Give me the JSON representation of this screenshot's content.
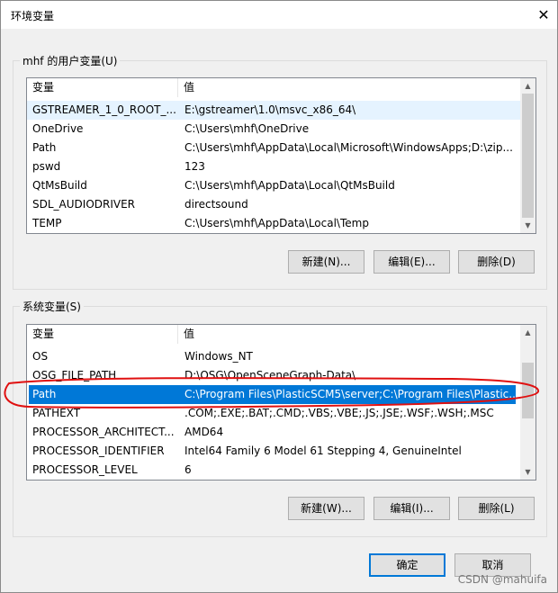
{
  "window": {
    "title": "环境变量",
    "close_glyph": "✕"
  },
  "user_vars": {
    "group_label": "mhf 的用户变量(U)",
    "columns": [
      "变量",
      "值"
    ],
    "rows": [
      {
        "name": "GSTREAMER_1_0_ROOT_...",
        "value": "E:\\gstreamer\\1.0\\msvc_x86_64\\"
      },
      {
        "name": "OneDrive",
        "value": "C:\\Users\\mhf\\OneDrive"
      },
      {
        "name": "Path",
        "value": "C:\\Users\\mhf\\AppData\\Local\\Microsoft\\WindowsApps;D:\\zip..."
      },
      {
        "name": "pswd",
        "value": "123"
      },
      {
        "name": "QtMsBuild",
        "value": "C:\\Users\\mhf\\AppData\\Local\\QtMsBuild"
      },
      {
        "name": "SDL_AUDIODRIVER",
        "value": "directsound"
      },
      {
        "name": "TEMP",
        "value": "C:\\Users\\mhf\\AppData\\Local\\Temp"
      }
    ],
    "buttons": {
      "new": "新建(N)...",
      "edit": "编辑(E)...",
      "delete": "删除(D)"
    }
  },
  "system_vars": {
    "group_label": "系统变量(S)",
    "columns": [
      "变量",
      "值"
    ],
    "rows": [
      {
        "name": "OS",
        "value": "Windows_NT"
      },
      {
        "name": "OSG_FILE_PATH",
        "value": "D:\\OSG\\OpenSceneGraph-Data\\"
      },
      {
        "name": "Path",
        "value": "C:\\Program Files\\PlasticSCM5\\server;C:\\Program Files\\Plastic..."
      },
      {
        "name": "PATHEXT",
        "value": ".COM;.EXE;.BAT;.CMD;.VBS;.VBE;.JS;.JSE;.WSF;.WSH;.MSC"
      },
      {
        "name": "PROCESSOR_ARCHITECT...",
        "value": "AMD64"
      },
      {
        "name": "PROCESSOR_IDENTIFIER",
        "value": "Intel64 Family 6 Model 61 Stepping 4, GenuineIntel"
      },
      {
        "name": "PROCESSOR_LEVEL",
        "value": "6"
      }
    ],
    "selected_row": "Path",
    "buttons": {
      "new": "新建(W)...",
      "edit": "编辑(I)...",
      "delete": "删除(L)"
    }
  },
  "footer": {
    "ok": "确定",
    "cancel": "取消"
  },
  "watermark": "CSDN @mahuifa",
  "colors": {
    "selection": "#0078d7",
    "annotation": "#e01010",
    "default_button_border": "#0078d7"
  }
}
